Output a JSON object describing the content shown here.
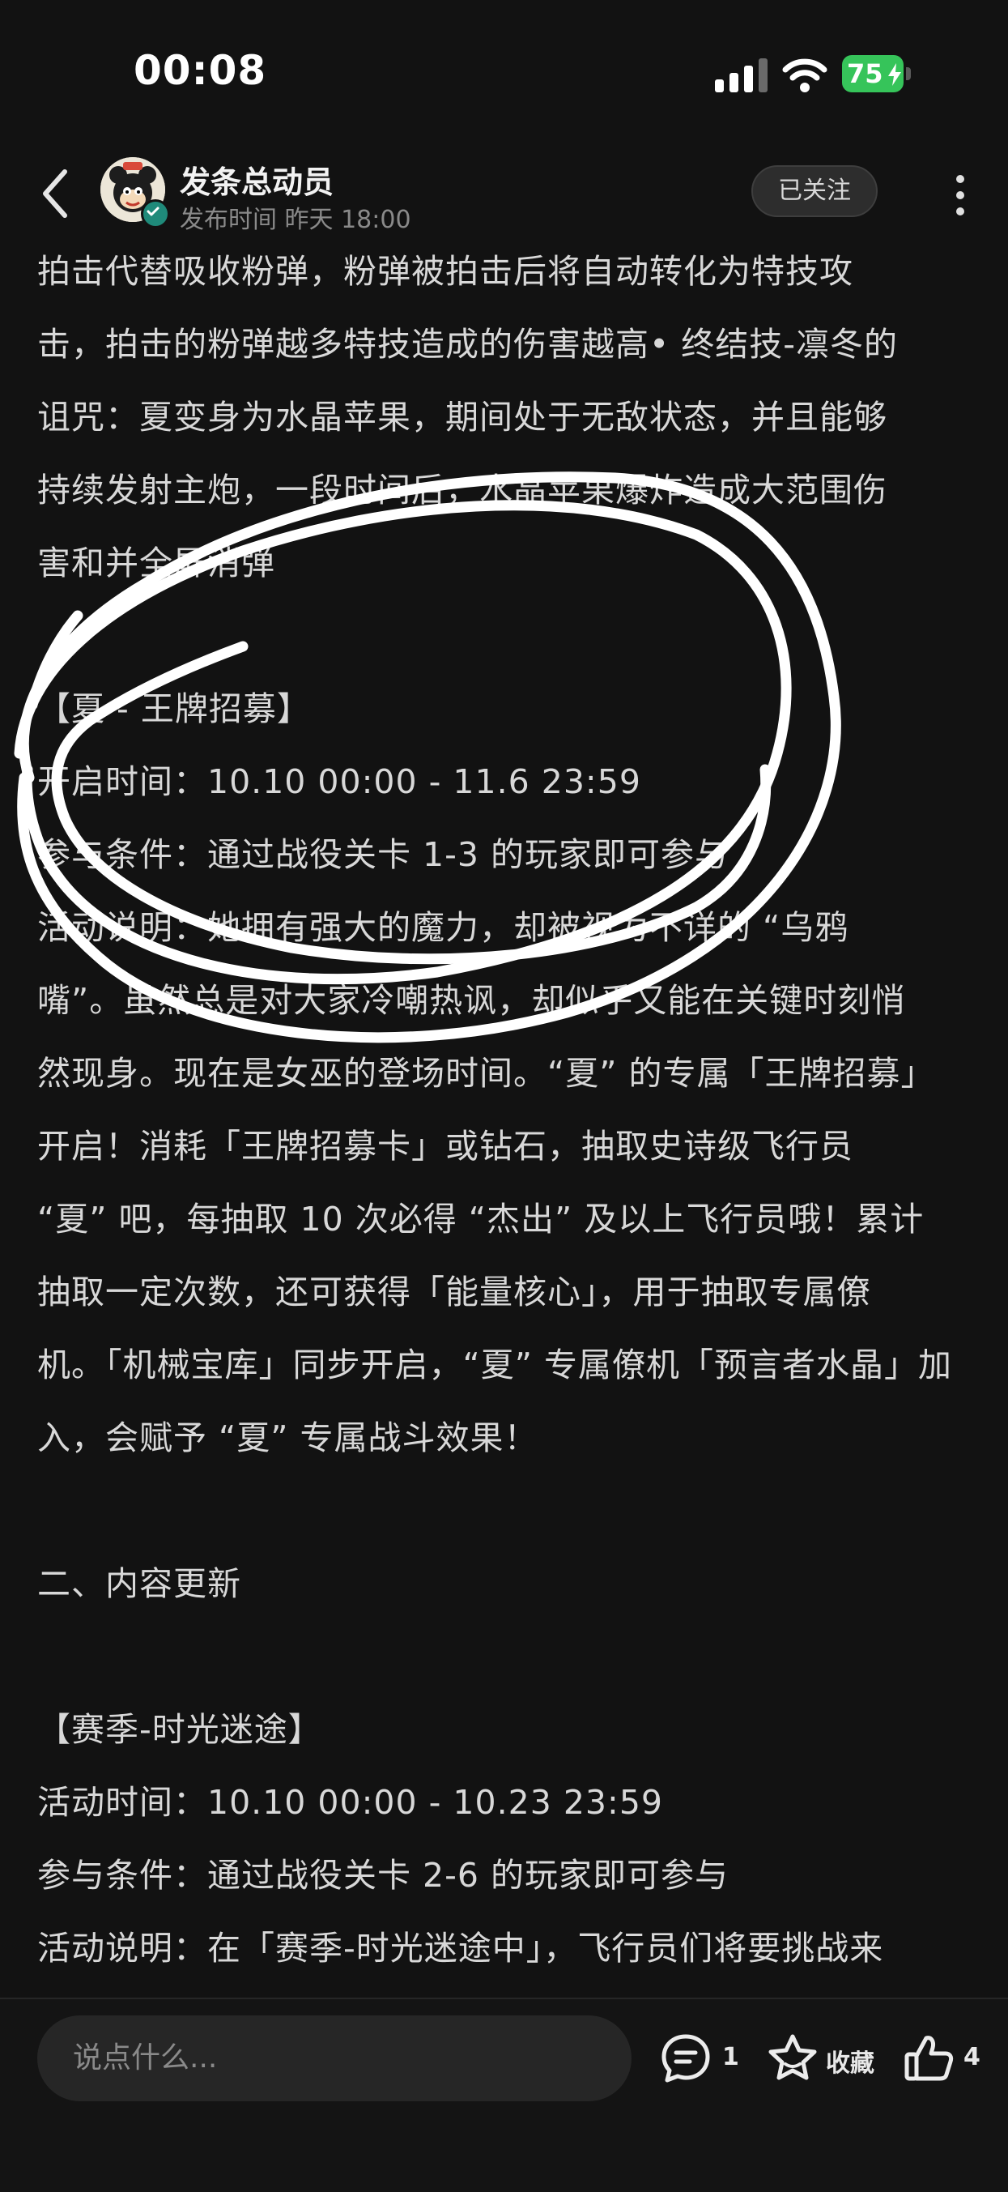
{
  "status_bar": {
    "time": "00:08",
    "battery": "75",
    "icons": [
      "cellular-signal-icon",
      "wifi-icon",
      "battery-charging-icon"
    ]
  },
  "header": {
    "author_name": "发条总动员",
    "post_time": "发布时间 昨天 18:00",
    "follow_label": "已关注",
    "icons": [
      "back-arrow-icon",
      "verified-badge-icon",
      "more-vertical-icon"
    ]
  },
  "article": {
    "lines": [
      "拍击代替吸收粉弹，粉弹被拍击后将自动转化为特技攻",
      "击，拍击的粉弹越多特技造成的伤害越高• 终结技-凛冬的",
      "诅咒：夏变身为水晶苹果，期间处于无敌状态，并且能够",
      "持续发射主炮，一段时间后，水晶苹果爆炸造成大范围伤",
      "害和并全屏消弹",
      "",
      "【夏 - 王牌招募】",
      "开启时间：10.10 00:00 - 11.6 23:59",
      "参与条件：通过战役关卡 1-3 的玩家即可参与",
      "活动说明：她拥有强大的魔力，却被视为不详的 “乌鸦",
      "嘴”。虽然总是对大家冷嘲热讽，却似乎又能在关键时刻悄",
      "然现身。现在是女巫的登场时间。“夏” 的专属「王牌招募」",
      "开启！消耗「王牌招募卡」或钻石，抽取史诗级飞行员",
      "“夏” 吧，每抽取 10 次必得 “杰出” 及以上飞行员哦！累计",
      "抽取一定次数，还可获得「能量核心」，用于抽取专属僚",
      "机。「机械宝库」同步开启，“夏” 专属僚机「预言者水晶」加",
      "入，会赋予 “夏” 专属战斗效果！",
      "",
      "二、内容更新",
      "",
      "【赛季-时光迷途】",
      "活动时间：10.10 00:00 - 10.23 23:59",
      "参与条件：通过战役关卡 2-6 的玩家即可参与",
      "活动说明：在「赛季-时光迷途中」，飞行员们将要挑战来"
    ]
  },
  "bottom_bar": {
    "comment_placeholder": "说点什么...",
    "comment_count": "1",
    "favorite_label": "收藏",
    "like_count": "4",
    "icons": [
      "comment-icon",
      "star-icon",
      "thumbs-up-icon"
    ]
  }
}
